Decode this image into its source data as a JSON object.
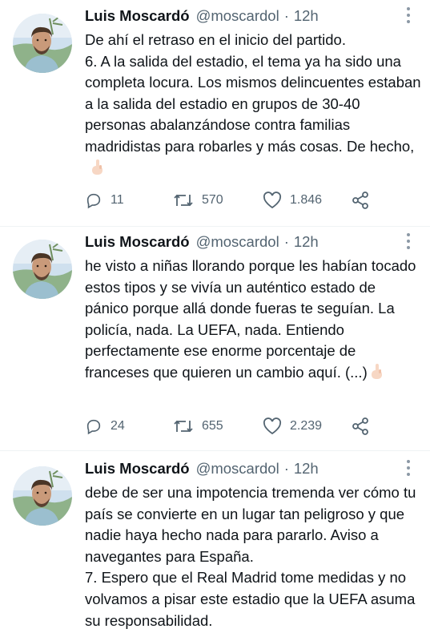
{
  "tweets": [
    {
      "name": "Luis Moscardó",
      "handle": "@moscardol",
      "separator": "·",
      "time": "12h",
      "text": "De ahí el retraso en el inicio del partido.\n6. A la salida del estadio, el tema ya ha sido una completa locura. Los mismos delincuentes estaban a la salida del estadio en grupos de 30-40 personas abalanzándose contra familias madridistas para robarles y más cosas. De hecho,",
      "emoji": "backhand-index-pointing-down",
      "replies": "11",
      "retweets": "570",
      "likes": "1.846"
    },
    {
      "name": "Luis Moscardó",
      "handle": "@moscardol",
      "separator": "·",
      "time": "12h",
      "text": "he visto a niñas llorando porque les habían tocado estos tipos y se vivía un auténtico estado de pánico porque allá donde fueras te seguían. La policía, nada. La UEFA, nada. Entiendo perfectamente ese enorme porcentaje de franceses que quieren un cambio aquí. (...)",
      "emoji": "backhand-index-pointing-down",
      "replies": "24",
      "retweets": "655",
      "likes": "2.239"
    },
    {
      "name": "Luis Moscardó",
      "handle": "@moscardol",
      "separator": "·",
      "time": "12h",
      "text": "debe de ser una impotencia tremenda ver cómo tu país se convierte en un lugar tan peligroso y que nadie haya hecho nada para pararlo. Aviso a navegantes para España.\n7. Espero que el Real Madrid tome medidas y no volvamos a pisar este estadio que la UEFA asuma su responsabilidad."
    }
  ],
  "colors": {
    "text": "#0f1419",
    "secondary": "#536471",
    "background": "#ffffff"
  },
  "icons": [
    "reply-icon",
    "retweet-icon",
    "like-icon",
    "share-icon",
    "more-icon"
  ]
}
